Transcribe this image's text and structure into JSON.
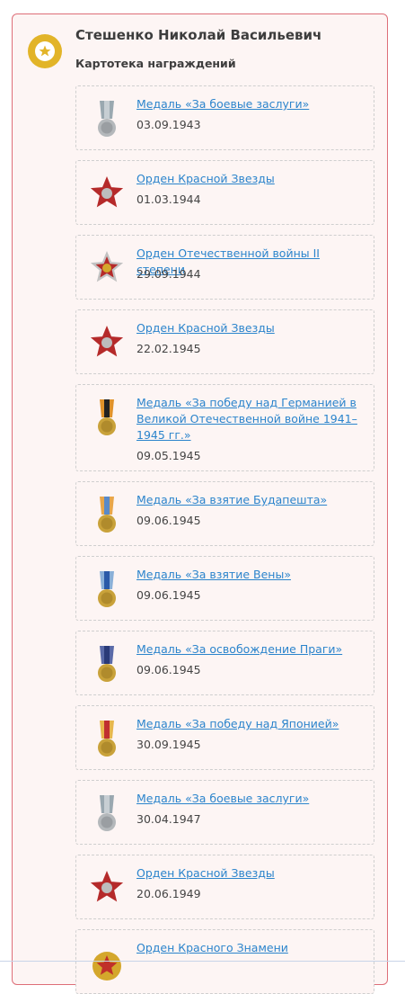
{
  "person": {
    "name": "Стешенко Николай Васильевич",
    "section": "Картотека награждений"
  },
  "colors": {
    "border": "#de6e78",
    "link": "#2b84cc",
    "panel": "#fdf5f4",
    "badge": "#e2b428"
  },
  "awards": [
    {
      "title": "Медаль «За боевые заслуги»",
      "date": "03.09.1943",
      "icon": "medal-combat-merit-icon"
    },
    {
      "title": "Орден Красной Звезды",
      "date": "01.03.1944",
      "icon": "red-star-order-icon"
    },
    {
      "title": "Орден Отечественной войны II степени",
      "date": "29.09.1944",
      "icon": "patriotic-war-order-icon"
    },
    {
      "title": "Орден Красной Звезды",
      "date": "22.02.1945",
      "icon": "red-star-order-icon"
    },
    {
      "title": "Медаль «За победу над Германией в Великой Отечественной войне 1941–1945 гг.»",
      "date": "09.05.1945",
      "icon": "victory-germany-medal-icon"
    },
    {
      "title": "Медаль «За взятие Будапешта»",
      "date": "09.06.1945",
      "icon": "budapest-medal-icon"
    },
    {
      "title": "Медаль «За взятие Вены»",
      "date": "09.06.1945",
      "icon": "vienna-medal-icon"
    },
    {
      "title": "Медаль «За освобождение Праги»",
      "date": "09.06.1945",
      "icon": "prague-medal-icon"
    },
    {
      "title": "Медаль «За победу над Японией»",
      "date": "30.09.1945",
      "icon": "victory-japan-medal-icon"
    },
    {
      "title": "Медаль «За боевые заслуги»",
      "date": "30.04.1947",
      "icon": "medal-combat-merit-icon"
    },
    {
      "title": "Орден Красной Звезды",
      "date": "20.06.1949",
      "icon": "red-star-order-icon"
    },
    {
      "title": "Орден Красного Знамени",
      "date": "",
      "icon": "red-banner-order-icon"
    }
  ]
}
